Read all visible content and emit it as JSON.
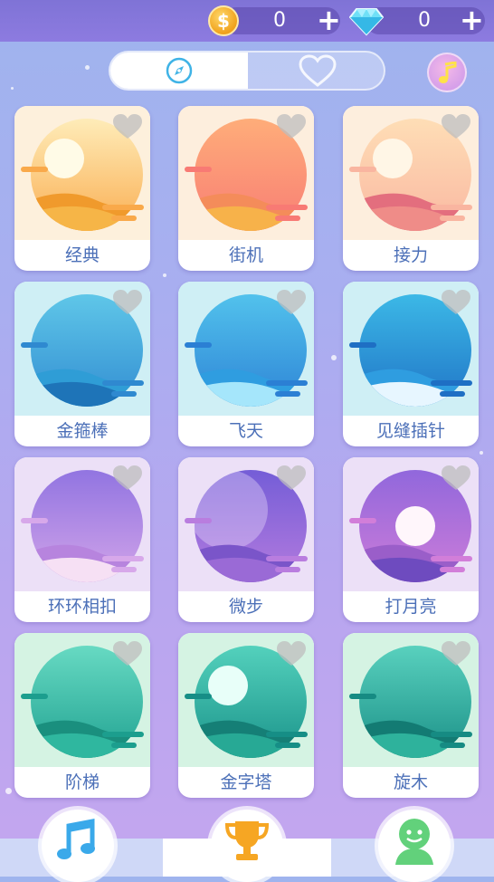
{
  "currency": {
    "coins": "0",
    "gems": "0",
    "coin_symbol": "$",
    "plus_label": "+"
  },
  "tabs": [
    {
      "icon": "compass-icon",
      "active": true
    },
    {
      "icon": "heart-icon",
      "active": false
    }
  ],
  "music_button": {
    "icon": "music-note-icon"
  },
  "songs": [
    {
      "title": "经典",
      "theme": "desert-sunset",
      "bg": "#fdf0dc"
    },
    {
      "title": "街机",
      "theme": "forest-deer",
      "bg": "#fdeedd"
    },
    {
      "title": "接力",
      "theme": "canyon-camel",
      "bg": "#fdeedd"
    },
    {
      "title": "金箍棒",
      "theme": "whale",
      "bg": "#cfeff5"
    },
    {
      "title": "飞天",
      "theme": "stag",
      "bg": "#cfeff5"
    },
    {
      "title": "见缝插针",
      "theme": "wolf-flowers",
      "bg": "#cfeff5"
    },
    {
      "title": "环环相扣",
      "theme": "purple-clouds",
      "bg": "#ece0f7"
    },
    {
      "title": "微步",
      "theme": "purple-moon",
      "bg": "#ece0f7"
    },
    {
      "title": "打月亮",
      "theme": "moon-traveler",
      "bg": "#ece0f7"
    },
    {
      "title": "阶梯",
      "theme": "green-hills",
      "bg": "#d5f3e3"
    },
    {
      "title": "金字塔",
      "theme": "windmill",
      "bg": "#d5f3e3"
    },
    {
      "title": "旋木",
      "theme": "leaping-deer",
      "bg": "#d5f3e3"
    }
  ],
  "bottom_nav": [
    {
      "icon": "music-notes-icon"
    },
    {
      "icon": "trophy-icon"
    },
    {
      "icon": "profile-avatar-icon"
    }
  ]
}
